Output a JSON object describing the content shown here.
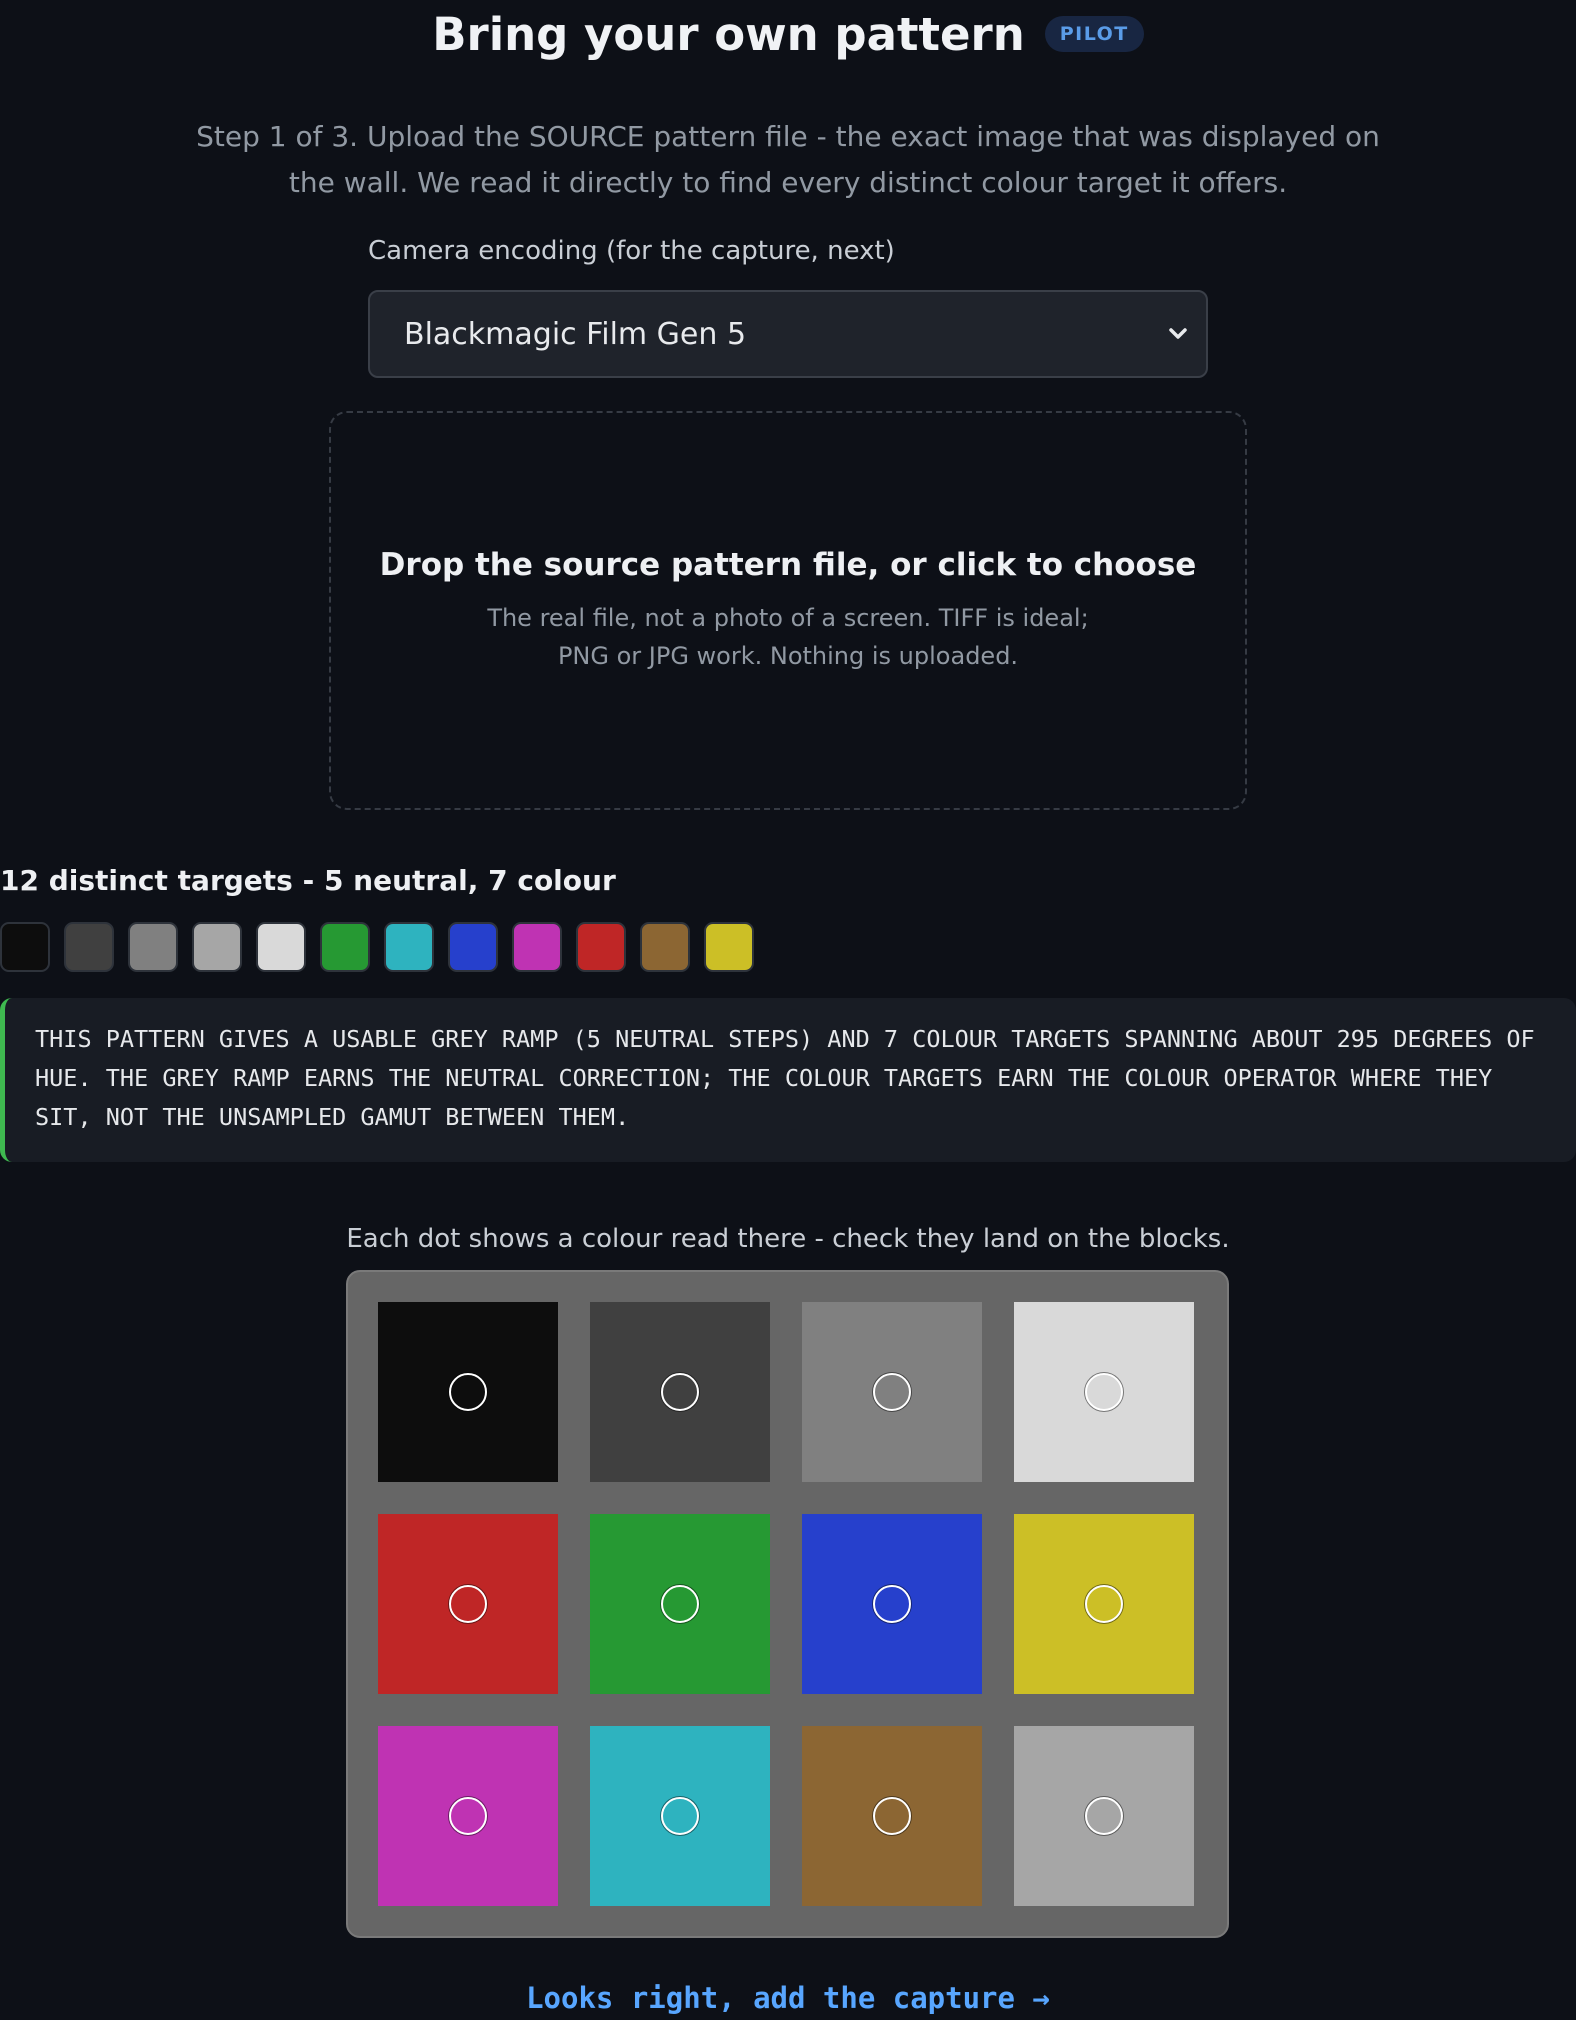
{
  "header": {
    "title": "Bring your own pattern",
    "badge": "PILOT"
  },
  "intro": "Step 1 of 3. Upload the SOURCE pattern file - the exact image that was displayed on the wall. We read it directly to find every distinct colour target it offers.",
  "encoding": {
    "label": "Camera encoding (for the capture, next)",
    "selected": "Blackmagic Film Gen 5",
    "icon": "chevron-down-icon"
  },
  "dropzone": {
    "title": "Drop the source pattern file, or click to choose",
    "line1": "The real file, not a photo of a screen. TIFF is ideal;",
    "line2": "PNG or JPG work. Nothing is uploaded."
  },
  "targets": {
    "heading": "12 distinct targets - 5 neutral, 7 colour",
    "swatches": [
      "#0d0d0d",
      "#404040",
      "#808080",
      "#a6a6a6",
      "#d9d9d9",
      "#269933",
      "#2eb3bf",
      "#2640cc",
      "#bf33b3",
      "#bf2626",
      "#8c6633",
      "#ccbf26"
    ]
  },
  "note": "This pattern gives a usable grey ramp (5 neutral steps) and 7 colour targets spanning about 295 degrees of hue. The grey ramp earns the neutral correction; the colour targets earn the colour operator where they sit, not the unsampled gamut between them.",
  "check": {
    "caption": "Each dot shows a colour read there - check they land on the blocks.",
    "pattern_background": "#666666",
    "blocks": [
      [
        "#0d0d0d",
        "#404040",
        "#808080",
        "#d9d9d9"
      ],
      [
        "#bf2626",
        "#269933",
        "#2640cc",
        "#ccbf26"
      ],
      [
        "#bf33b3",
        "#2eb3bf",
        "#8c6633",
        "#a6a6a6"
      ]
    ]
  },
  "next_link": "Looks right, add the capture →"
}
